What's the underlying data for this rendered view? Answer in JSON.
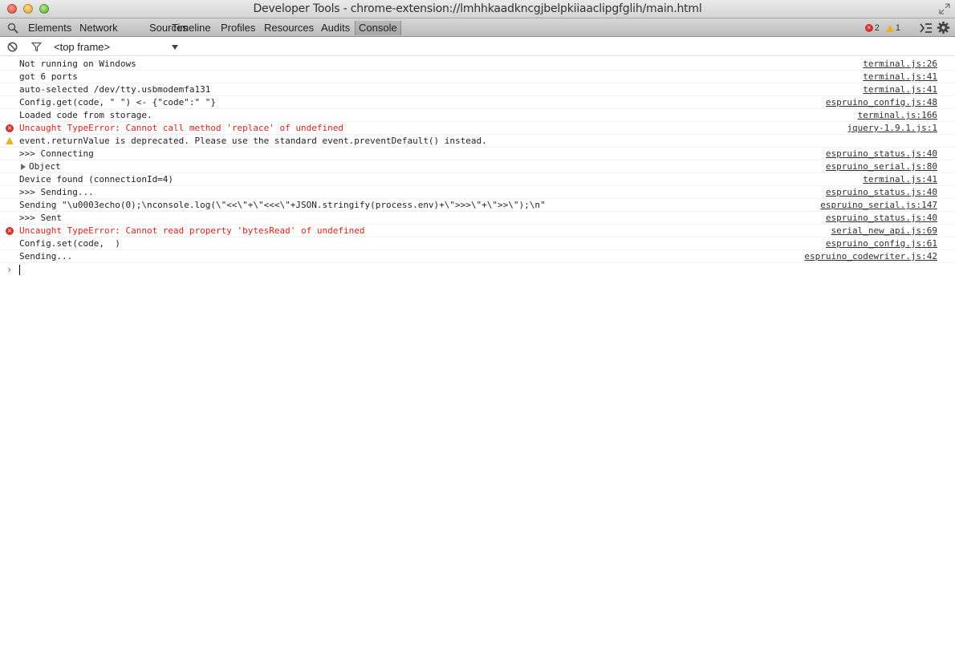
{
  "window": {
    "title": "Developer Tools - chrome-extension://lmhhkaadkncgjbelpkiiaaclipgfglih/main.html"
  },
  "toolbar": {
    "tabs": [
      {
        "label": "Elements",
        "selected": false
      },
      {
        "label": "Network",
        "selected": false
      },
      {
        "label": "Sources",
        "selected": false
      },
      {
        "label": "Timeline",
        "selected": false
      },
      {
        "label": "Profiles",
        "selected": false
      },
      {
        "label": "Resources",
        "selected": false
      },
      {
        "label": "Audits",
        "selected": false
      },
      {
        "label": "Console",
        "selected": true
      }
    ],
    "error_count": "2",
    "warning_count": "1"
  },
  "filterbar": {
    "frame": "<top frame>"
  },
  "console": {
    "messages": [
      {
        "level": "log",
        "text": "Not running on Windows",
        "source": "terminal.js:26"
      },
      {
        "level": "log",
        "text": "got 6 ports",
        "source": "terminal.js:41"
      },
      {
        "level": "log",
        "text": "auto-selected /dev/tty.usbmodemfa131",
        "source": "terminal.js:41"
      },
      {
        "level": "log",
        "text": "Config.get(code, \" \") <- {\"code\":\" \"}",
        "source": "espruino_config.js:48"
      },
      {
        "level": "log",
        "text": "Loaded code from storage.",
        "source": "terminal.js:166"
      },
      {
        "level": "error",
        "text": "Uncaught TypeError: Cannot call method 'replace' of undefined",
        "source": "jquery-1.9.1.js:1"
      },
      {
        "level": "warning",
        "text": "event.returnValue is deprecated. Please use the standard event.preventDefault() instead.",
        "source": ""
      },
      {
        "level": "log",
        "text": ">>> Connecting",
        "source": "espruino_status.js:40"
      },
      {
        "level": "object",
        "text": "Object",
        "source": "espruino_serial.js:80"
      },
      {
        "level": "log",
        "text": "Device found (connectionId=4)",
        "source": "terminal.js:41"
      },
      {
        "level": "log",
        "text": ">>> Sending...",
        "source": "espruino_status.js:40"
      },
      {
        "level": "log",
        "text": "Sending \"\\u0003echo(0);\\nconsole.log(\\\"<<\\\"+\\\"<<<\\\"+JSON.stringify(process.env)+\\\">>>\\\"+\\\">>\\\");\\n\"",
        "source": "espruino_serial.js:147"
      },
      {
        "level": "log",
        "text": ">>> Sent",
        "source": "espruino_status.js:40"
      },
      {
        "level": "error",
        "text": "Uncaught TypeError: Cannot read property 'bytesRead' of undefined",
        "source": "serial_new_api.js:69"
      },
      {
        "level": "log",
        "text": "Config.set(code,  )",
        "source": "espruino_config.js:61"
      },
      {
        "level": "log",
        "text": "Sending...",
        "source": "espruino_codewriter.js:42"
      }
    ],
    "prompt_symbol": "›"
  },
  "colors": {
    "error_text": "#e0201a",
    "prompt": "#2b6be0",
    "warning_icon": "#e8b321",
    "error_icon": "#d8302a"
  }
}
